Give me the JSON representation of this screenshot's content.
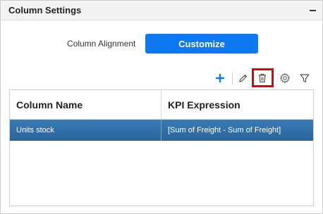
{
  "panel": {
    "title": "Column Settings"
  },
  "alignment": {
    "label": "Column Alignment",
    "button_label": "Customize"
  },
  "toolbar": {
    "icons": [
      "plus-icon",
      "pencil-icon",
      "trash-icon",
      "gear-icon",
      "filter-icon"
    ],
    "accent": "#0d78f2",
    "highlight_color": "#e60000"
  },
  "grid": {
    "columns": [
      "Column Name",
      "KPI Expression"
    ],
    "rows": [
      {
        "column_name": "Units stock",
        "kpi_expression": "[Sum of Freight - Sum of Freight]",
        "selected": true
      }
    ],
    "selected_row_color": "#2d6da6"
  }
}
